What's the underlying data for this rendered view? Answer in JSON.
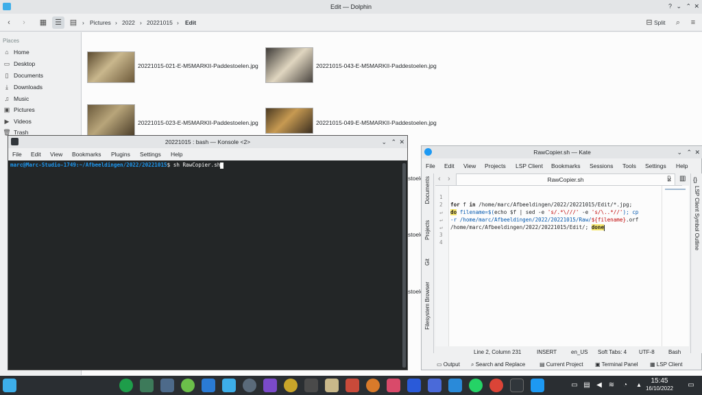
{
  "dolphin": {
    "title": "Edit — Dolphin",
    "breadcrumbs": [
      "Pictures",
      "2022",
      "20221015",
      "Edit"
    ],
    "split_label": "Split",
    "places_header": "Places",
    "places": [
      {
        "icon": "home-icon",
        "label": "Home"
      },
      {
        "icon": "desktop-icon",
        "label": "Desktop"
      },
      {
        "icon": "documents-icon",
        "label": "Documents"
      },
      {
        "icon": "downloads-icon",
        "label": "Downloads"
      },
      {
        "icon": "music-icon",
        "label": "Music"
      },
      {
        "icon": "pictures-icon",
        "label": "Pictures"
      },
      {
        "icon": "videos-icon",
        "label": "Videos"
      },
      {
        "icon": "trash-icon",
        "label": "Trash"
      }
    ],
    "files": [
      {
        "name": "20221015-021-E-M5MARKII-Paddestoelen.jpg",
        "color": "#8a7a55"
      },
      {
        "name": "20221015-043-E-M5MARKII-Paddestoelen.jpg",
        "color": "#5a5550"
      },
      {
        "name": "20221015-023-E-M5MARKII-Paddestoelen.jpg",
        "color": "#7d6e4e"
      },
      {
        "name": "20221015-049-E-M5MARKII-Paddestoelen.jpg",
        "color": "#9a7a4a"
      }
    ],
    "partial_labels": [
      "stoele",
      "stoele",
      "stoele"
    ]
  },
  "konsole": {
    "title": "20221015 : bash — Konsole <2>",
    "menu": [
      "File",
      "Edit",
      "View",
      "Bookmarks",
      "Plugins",
      "Settings",
      "Help"
    ],
    "prompt_user": "marc@Marc-Studio-1749",
    "prompt_path": ":~/Afbeeldingen/2022/20221015",
    "prompt_symbol": "$",
    "command": " sh RawCopier.sh"
  },
  "kate": {
    "title": "RawCopier.sh — Kate",
    "menu": [
      "File",
      "Edit",
      "View",
      "Projects",
      "LSP Client",
      "Bookmarks",
      "Sessions",
      "Tools",
      "Settings",
      "Help"
    ],
    "tab_name": "RawCopier.sh",
    "left_tools": [
      "Documents",
      "Projects",
      "Git",
      "Filesystem Browser"
    ],
    "right_tools": "LSP Client Symbol Outline",
    "line_numbers": [
      "1",
      "2",
      "↵",
      "↵",
      "↵",
      "3",
      "4"
    ],
    "code": {
      "l2_kw1": "for",
      "l2_rest": " f ",
      "l2_kw2": "in",
      "l2_path": " /home/marc/Afbeeldingen/2022/20221015/Edit/*.jpg;",
      "l3_do": "do",
      "l3_var": " filename=$(",
      "l3_echo": "echo $f | sed -e ",
      "l3_str1": "'s/.*\\///'",
      "l3_mid": " -e ",
      "l3_str2": "'s/\\..*//'",
      "l3_end": "); cp",
      "l4": "-r /home/marc/Afbeeldingen/2022/20221015/Raw/",
      "l4_var": "${filename}",
      "l4_end": ".orf",
      "l5": "/home/marc/Afbeeldingen/2022/20221015/Edit/; ",
      "l5_done": "done"
    },
    "status": {
      "position": "Line 2, Column 231",
      "mode": "INSERT",
      "lang": "en_US",
      "tabs": "Soft Tabs: 4",
      "encoding": "UTF-8",
      "syntax": "Bash"
    },
    "bottom": [
      "Output",
      "Search and Replace",
      "Current Project",
      "Terminal Panel",
      "LSP Client"
    ]
  },
  "taskbar": {
    "time": "15:45",
    "date": "16/10/2022"
  }
}
